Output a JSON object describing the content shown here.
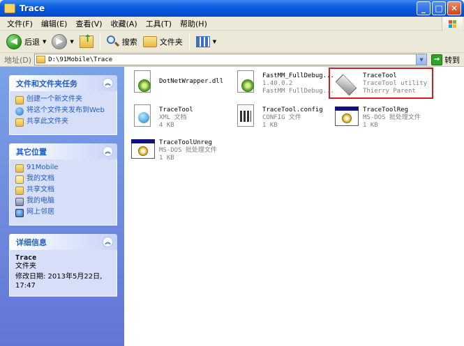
{
  "window": {
    "title": "Trace"
  },
  "menu": [
    "文件(F)",
    "编辑(E)",
    "查看(V)",
    "收藏(A)",
    "工具(T)",
    "帮助(H)"
  ],
  "toolbar": {
    "back_label": "后退",
    "search_label": "搜索",
    "folders_label": "文件夹"
  },
  "address": {
    "label": "地址(D)",
    "path": "D:\\91Mobile\\Trace",
    "go_label": "转到"
  },
  "panels": {
    "tasks": {
      "title": "文件和文件夹任务",
      "items": [
        "创建一个新文件夹",
        "将这个文件夹发布到Web",
        "共享此文件夹"
      ]
    },
    "places": {
      "title": "其它位置",
      "items": [
        "91Mobile",
        "我的文档",
        "共享文档",
        "我的电脑",
        "网上邻居"
      ]
    },
    "details": {
      "title": "详细信息",
      "name": "Trace",
      "type": "文件夹",
      "modified": "修改日期: 2013年5月22日, 17:47"
    }
  },
  "files": [
    {
      "name": "DotNetWrapper.dll",
      "line2": "",
      "line3": ""
    },
    {
      "name": "FastMM_FullDebug...",
      "line2": "1.40.0.2",
      "line3": "FastMM FullDebug..."
    },
    {
      "name": "TraceTool",
      "line2": "TraceTool utility",
      "line3": "Thierry Parent"
    },
    {
      "name": "TraceTool",
      "line2": "XML 文档",
      "line3": "4 KB"
    },
    {
      "name": "TraceTool.config",
      "line2": "CONFIG 文件",
      "line3": "1 KB"
    },
    {
      "name": "TraceToolReg",
      "line2": "MS-DOS 批处理文件",
      "line3": "1 KB"
    },
    {
      "name": "TraceToolUnreg",
      "line2": "MS-DOS 批处理文件",
      "line3": "1 KB"
    }
  ]
}
